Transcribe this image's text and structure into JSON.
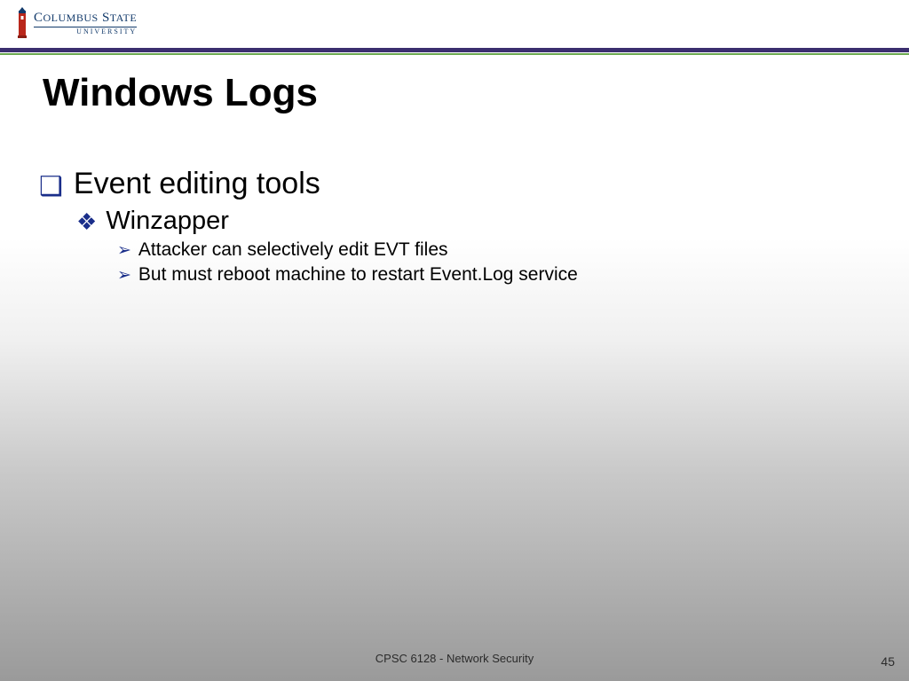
{
  "logo": {
    "line1_a": "C",
    "line1_b": "OLUMBUS",
    "line1_c": " S",
    "line1_d": "TATE",
    "line2": "UNIVERSITY"
  },
  "title": "Windows Logs",
  "bullets": {
    "lvl1": {
      "text": "Event editing tools"
    },
    "lvl2": {
      "text": "Winzapper"
    },
    "lvl3a": {
      "text": "Attacker can selectively edit EVT files"
    },
    "lvl3b": {
      "text": "But must reboot machine to restart Event.Log service"
    }
  },
  "footer": "CPSC 6128 - Network Security",
  "page": "45",
  "glyphs": {
    "square": "❑",
    "diamond": "❖",
    "arrow": "➢"
  }
}
